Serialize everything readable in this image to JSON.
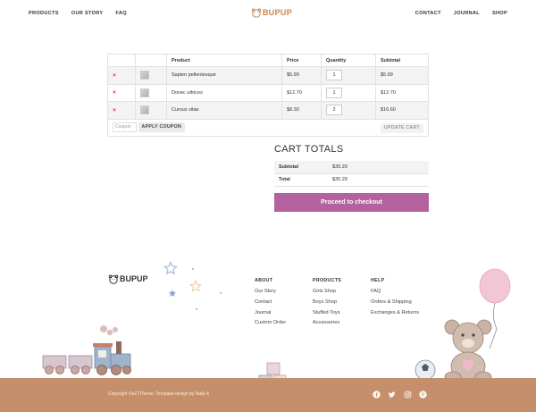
{
  "header": {
    "nav_left": [
      "PRODUCTS",
      "OUR STORY",
      "FAQ"
    ],
    "logo_text": "BUPUP",
    "nav_right": [
      "CONTACT",
      "JOURNAL",
      "SHOP"
    ]
  },
  "cart": {
    "columns": [
      "",
      "",
      "Product",
      "Price",
      "Quantity",
      "Subtotal"
    ],
    "items": [
      {
        "product": "Sapien pellentesque",
        "price": "$5.99",
        "quantity": "1",
        "subtotal": "$5.99"
      },
      {
        "product": "Donec ultrices",
        "price": "$12.70",
        "quantity": "1",
        "subtotal": "$12.70"
      },
      {
        "product": "Cursus vitae",
        "price": "$8.30",
        "quantity": "2",
        "subtotal": "$16.60"
      }
    ],
    "remove_icon": "×",
    "coupon_placeholder": "Coupon",
    "apply_coupon_label": "APPLY COUPON",
    "update_cart_label": "UPDATE CART"
  },
  "totals": {
    "title": "CART TOTALS",
    "subtotal_label": "Subtotal",
    "subtotal_value": "$35.29",
    "total_label": "Total",
    "total_value": "$35.29",
    "checkout_label": "Proceed to checkout"
  },
  "footer": {
    "logo_text": "BUPUP",
    "about": {
      "title": "ABOUT",
      "links": [
        "Our Story",
        "Contact",
        "Journal",
        "Custom Order"
      ]
    },
    "products": {
      "title": "PRODUCTS",
      "links": [
        "Girls Shop",
        "Boys Shop",
        "Stuffed Toys",
        "Accessories"
      ]
    },
    "help": {
      "title": "HELP",
      "links": [
        "FAQ",
        "Orders & Shipping",
        "Exchanges & Returns"
      ]
    },
    "copyright": "Copyright ©aZ7Theme. Template design by Nally-k",
    "social_icons": [
      "facebook-icon",
      "twitter-icon",
      "instagram-icon",
      "pinterest-icon"
    ]
  },
  "colors": {
    "accent": "#b4619f",
    "brand": "#c9844f",
    "footer_bar": "#c58f6b"
  }
}
